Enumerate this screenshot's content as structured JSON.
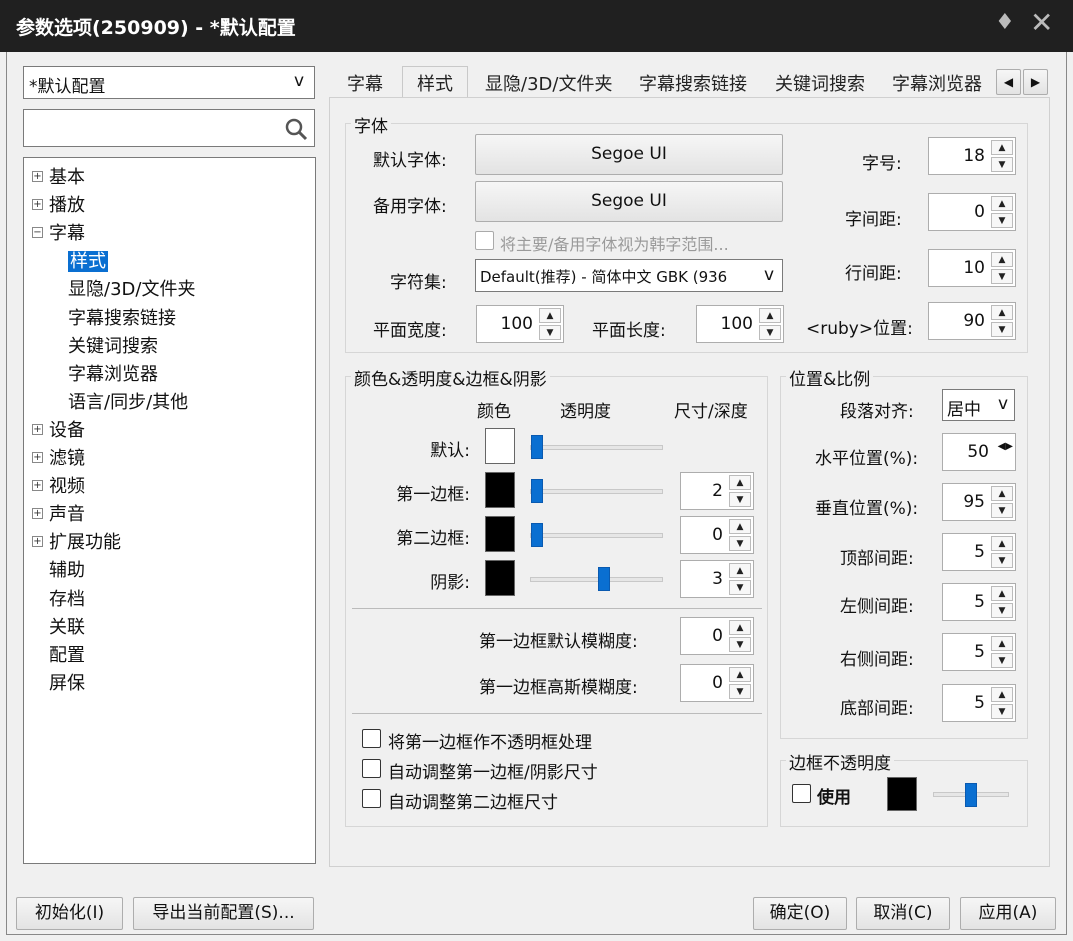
{
  "window": {
    "title": "参数选项(250909) - *默认配置",
    "pin_glyph": "♦",
    "close_glyph": "✕"
  },
  "profile": {
    "selected": "*默认配置",
    "arrow": "v"
  },
  "search": {
    "placeholder": ""
  },
  "tree": {
    "items": [
      {
        "label": "基本",
        "expander": "+"
      },
      {
        "label": "播放",
        "expander": "+"
      },
      {
        "label": "字幕",
        "expander": "−"
      },
      {
        "label": "样式"
      },
      {
        "label": "显隐/3D/文件夹"
      },
      {
        "label": "字幕搜索链接"
      },
      {
        "label": "关键词搜索"
      },
      {
        "label": "字幕浏览器"
      },
      {
        "label": "语言/同步/其他"
      },
      {
        "label": "设备",
        "expander": "+"
      },
      {
        "label": "滤镜",
        "expander": "+"
      },
      {
        "label": "视频",
        "expander": "+"
      },
      {
        "label": "声音",
        "expander": "+"
      },
      {
        "label": "扩展功能",
        "expander": "+"
      },
      {
        "label": "辅助"
      },
      {
        "label": "存档"
      },
      {
        "label": "关联"
      },
      {
        "label": "配置"
      },
      {
        "label": "屏保"
      }
    ]
  },
  "tabs": [
    "字幕",
    "样式",
    "显隐/3D/文件夹",
    "字幕搜索链接",
    "关键词搜索",
    "字幕浏览器"
  ],
  "tab_scroll": {
    "left": "◀",
    "right": "▶"
  },
  "font": {
    "group_title": "字体",
    "default_label": "默认字体:",
    "default_value": "Segoe UI",
    "backup_label": "备用字体:",
    "backup_value": "Segoe UI",
    "hangul_check_label": "将主要/备用字体视为韩字范围...",
    "charset_label": "字符集:",
    "charset_value": "Default(推荐) - 简体中文 GBK (936",
    "plane_width_label": "平面宽度:",
    "plane_width": "100",
    "plane_length_label": "平面长度:",
    "plane_length": "100",
    "size_label": "字号:",
    "size": "18",
    "spacing_label": "字间距:",
    "spacing": "0",
    "line_spacing_label": "行间距:",
    "line_spacing": "10",
    "ruby_label": "<ruby>位置:",
    "ruby": "90"
  },
  "color": {
    "group_title": "颜色&透明度&边框&阴影",
    "col_color": "颜色",
    "col_opacity": "透明度",
    "col_size": "尺寸/深度",
    "rows": [
      {
        "label": "默认:",
        "color": "#ffffff",
        "opacity": 0,
        "size": ""
      },
      {
        "label": "第一边框:",
        "color": "#000000",
        "opacity": 0,
        "size": "2"
      },
      {
        "label": "第二边框:",
        "color": "#000000",
        "opacity": 0,
        "size": "0"
      },
      {
        "label": "阴影:",
        "color": "#000000",
        "opacity": 0.55,
        "size": "3"
      }
    ],
    "blur_label": "第一边框默认模糊度:",
    "blur": "0",
    "gauss_label": "第一边框高斯模糊度:",
    "gauss": "0",
    "check1": "将第一边框作不透明框处理",
    "check2": "自动调整第一边框/阴影尺寸",
    "check3": "自动调整第二边框尺寸"
  },
  "position": {
    "group_title": "位置&比例",
    "align_label": "段落对齐:",
    "align_value": "居中",
    "h_label": "水平位置(%):",
    "h": "50",
    "v_label": "垂直位置(%):",
    "v": "95",
    "top_label": "顶部间距:",
    "top": "5",
    "left_label": "左侧间距:",
    "left": "5",
    "right_label": "右侧间距:",
    "right": "5",
    "bottom_label": "底部间距:",
    "bottom": "5"
  },
  "border_opacity": {
    "group_title": "边框不透明度",
    "use_label": "使用",
    "color": "#000000",
    "level": 0.5
  },
  "buttons": {
    "init": "初始化(I)",
    "export": "导出当前配置(S)...",
    "ok": "确定(O)",
    "cancel": "取消(C)",
    "apply": "应用(A)"
  },
  "spin_up": "▲",
  "spin_down": "▼"
}
